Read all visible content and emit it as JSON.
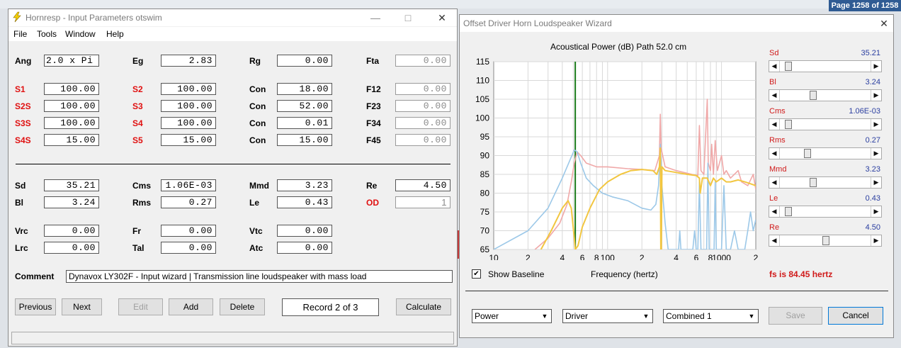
{
  "page_badge": "Page 1258 of 1258",
  "win1": {
    "title": "Hornresp - Input Parameters   otswim",
    "menu": [
      "File",
      "Tools",
      "Window",
      "Help"
    ],
    "row1": [
      {
        "label": "Ang",
        "value": "2.0 x Pi"
      },
      {
        "label": "Eg",
        "value": "2.83"
      },
      {
        "label": "Rg",
        "value": "0.00"
      },
      {
        "label": "Fta",
        "value": "0.00"
      }
    ],
    "horn": [
      [
        {
          "label": "S1",
          "value": "100.00"
        },
        {
          "label": "S2",
          "value": "100.00"
        },
        {
          "label": "Con",
          "value": "18.00"
        },
        {
          "label": "F12",
          "value": "0.00"
        }
      ],
      [
        {
          "label": "S2S",
          "value": "100.00"
        },
        {
          "label": "S3",
          "value": "100.00"
        },
        {
          "label": "Con",
          "value": "52.00"
        },
        {
          "label": "F23",
          "value": "0.00"
        }
      ],
      [
        {
          "label": "S3S",
          "value": "100.00"
        },
        {
          "label": "S4",
          "value": "100.00"
        },
        {
          "label": "Con",
          "value": "0.01"
        },
        {
          "label": "F34",
          "value": "0.00"
        }
      ],
      [
        {
          "label": "S4S",
          "value": "15.00"
        },
        {
          "label": "S5",
          "value": "15.00"
        },
        {
          "label": "Con",
          "value": "15.00"
        },
        {
          "label": "F45",
          "value": "0.00"
        }
      ]
    ],
    "driver": [
      [
        {
          "label": "Sd",
          "value": "35.21"
        },
        {
          "label": "Cms",
          "value": "1.06E-03"
        },
        {
          "label": "Mmd",
          "value": "3.23"
        },
        {
          "label": "Re",
          "value": "4.50"
        }
      ],
      [
        {
          "label": "Bl",
          "value": "3.24"
        },
        {
          "label": "Rms",
          "value": "0.27"
        },
        {
          "label": "Le",
          "value": "0.43"
        },
        {
          "label": "OD",
          "value": "1"
        }
      ]
    ],
    "chamber": [
      [
        {
          "label": "Vrc",
          "value": "0.00"
        },
        {
          "label": "Fr",
          "value": "0.00"
        },
        {
          "label": "Vtc",
          "value": "0.00"
        }
      ],
      [
        {
          "label": "Lrc",
          "value": "0.00"
        },
        {
          "label": "Tal",
          "value": "0.00"
        },
        {
          "label": "Atc",
          "value": "0.00"
        }
      ]
    ],
    "comment_label": "Comment",
    "comment_value": "Dynavox LY302F - Input wizard | Transmission line loudspeaker with mass load",
    "buttons": {
      "previous": "Previous",
      "next": "Next",
      "edit": "Edit",
      "add": "Add",
      "delete": "Delete",
      "calculate": "Calculate"
    },
    "record": "Record 2 of 3"
  },
  "win2": {
    "title": "Offset Driver Horn Loudspeaker Wizard",
    "chart_heading": "Acoustical Power (dB)   Path 52.0 cm",
    "show_baseline_label": "Show Baseline",
    "show_baseline_mark": "✔",
    "xlabel": "Frequency (hertz)",
    "fs_text": "fs is 84.45 hertz",
    "params": [
      {
        "name": "Sd",
        "value": "35.21",
        "pos": 0.06
      },
      {
        "name": "Bl",
        "value": "3.24",
        "pos": 0.36
      },
      {
        "name": "Cms",
        "value": "1.06E-03",
        "pos": 0.06
      },
      {
        "name": "Rms",
        "value": "0.27",
        "pos": 0.29
      },
      {
        "name": "Mmd",
        "value": "3.23",
        "pos": 0.36
      },
      {
        "name": "Le",
        "value": "0.43",
        "pos": 0.06
      },
      {
        "name": "Re",
        "value": "4.50",
        "pos": 0.51
      }
    ],
    "dropdowns": [
      "Power",
      "Driver",
      "Combined 1"
    ],
    "buttons": {
      "save": "Save",
      "cancel": "Cancel"
    }
  },
  "chart_data": {
    "type": "line",
    "title": "Acoustical Power (dB)   Path 52.0 cm",
    "xlabel": "Frequency (hertz)",
    "ylabel": "",
    "x_scale": "log",
    "xlim": [
      10,
      2000
    ],
    "ylim": [
      65,
      115
    ],
    "y_ticks": [
      65,
      70,
      75,
      80,
      85,
      90,
      95,
      100,
      105,
      110,
      115
    ],
    "x_tick_labels": [
      {
        "f": 10,
        "t": "10"
      },
      {
        "f": 20,
        "t": "2"
      },
      {
        "f": 40,
        "t": "4"
      },
      {
        "f": 60,
        "t": "6"
      },
      {
        "f": 80,
        "t": "8"
      },
      {
        "f": 100,
        "t": "100"
      },
      {
        "f": 200,
        "t": "2"
      },
      {
        "f": 400,
        "t": "4"
      },
      {
        "f": 600,
        "t": "6"
      },
      {
        "f": 800,
        "t": "8"
      },
      {
        "f": 1000,
        "t": "1000"
      },
      {
        "f": 2000,
        "t": "2"
      }
    ],
    "grid": true,
    "marker_line": {
      "x": 52,
      "color": "#1a7a1a"
    },
    "series": [
      {
        "color": "#f0a8a8",
        "points": [
          [
            23,
            65
          ],
          [
            30,
            68
          ],
          [
            38,
            72
          ],
          [
            44,
            77
          ],
          [
            48,
            83
          ],
          [
            51,
            88
          ],
          [
            54,
            91
          ],
          [
            58,
            90
          ],
          [
            65,
            88
          ],
          [
            80,
            87
          ],
          [
            100,
            87
          ],
          [
            150,
            86.5
          ],
          [
            200,
            86.3
          ],
          [
            260,
            86
          ],
          [
            285,
            90
          ],
          [
            290,
            101
          ],
          [
            295,
            92
          ],
          [
            320,
            87
          ],
          [
            400,
            86
          ],
          [
            550,
            85
          ],
          [
            620,
            84.7
          ],
          [
            640,
            98
          ],
          [
            660,
            86
          ],
          [
            700,
            85
          ],
          [
            750,
            105
          ],
          [
            765,
            88
          ],
          [
            800,
            86
          ],
          [
            820,
            93
          ],
          [
            850,
            85
          ],
          [
            880,
            94
          ],
          [
            920,
            86
          ],
          [
            1000,
            90
          ],
          [
            1050,
            85
          ],
          [
            1100,
            86
          ],
          [
            1200,
            84
          ],
          [
            1400,
            86
          ],
          [
            1500,
            83
          ],
          [
            1700,
            82
          ],
          [
            1900,
            85
          ],
          [
            2000,
            81
          ]
        ]
      },
      {
        "color": "#9cc8e8",
        "points": [
          [
            10,
            65
          ],
          [
            20,
            70
          ],
          [
            30,
            76
          ],
          [
            40,
            84
          ],
          [
            47,
            89
          ],
          [
            51,
            91.5
          ],
          [
            54,
            91
          ],
          [
            58,
            88
          ],
          [
            65,
            84
          ],
          [
            75,
            82
          ],
          [
            90,
            80
          ],
          [
            110,
            79
          ],
          [
            150,
            78
          ],
          [
            200,
            76
          ],
          [
            240,
            75.5
          ],
          [
            265,
            77
          ],
          [
            280,
            82
          ],
          [
            290,
            93
          ],
          [
            300,
            82
          ],
          [
            320,
            72
          ],
          [
            340,
            65
          ],
          [
            420,
            65
          ],
          [
            430,
            70
          ],
          [
            440,
            65
          ],
          [
            560,
            65
          ],
          [
            580,
            70
          ],
          [
            600,
            65
          ],
          [
            620,
            65
          ],
          [
            640,
            83
          ],
          [
            660,
            65
          ],
          [
            740,
            65
          ],
          [
            760,
            88
          ],
          [
            780,
            65
          ],
          [
            860,
            65
          ],
          [
            880,
            83
          ],
          [
            900,
            65
          ],
          [
            1000,
            65
          ],
          [
            1050,
            82
          ],
          [
            1100,
            65
          ],
          [
            1200,
            65
          ],
          [
            1300,
            70
          ],
          [
            1400,
            65
          ],
          [
            1600,
            65
          ],
          [
            1700,
            70
          ],
          [
            1800,
            75
          ],
          [
            1900,
            70
          ],
          [
            2000,
            73
          ]
        ]
      },
      {
        "color": "#f2c640",
        "points": [
          [
            26,
            65
          ],
          [
            32,
            70
          ],
          [
            40,
            76
          ],
          [
            45,
            78
          ],
          [
            48,
            76
          ],
          [
            51,
            68
          ],
          [
            52,
            65
          ],
          [
            55,
            66
          ],
          [
            60,
            71
          ],
          [
            70,
            76
          ],
          [
            85,
            81
          ],
          [
            100,
            83
          ],
          [
            130,
            85
          ],
          [
            160,
            86
          ],
          [
            200,
            86.3
          ],
          [
            250,
            86
          ],
          [
            270,
            85
          ],
          [
            285,
            87
          ],
          [
            290,
            92
          ],
          [
            293,
            65
          ],
          [
            296,
            65
          ],
          [
            300,
            87
          ],
          [
            320,
            86
          ],
          [
            400,
            85.5
          ],
          [
            500,
            85
          ],
          [
            600,
            84.7
          ],
          [
            640,
            84
          ],
          [
            650,
            80
          ],
          [
            680,
            84
          ],
          [
            750,
            84
          ],
          [
            800,
            82
          ],
          [
            850,
            84
          ],
          [
            900,
            83
          ],
          [
            1000,
            84
          ],
          [
            1100,
            83
          ],
          [
            1200,
            83
          ],
          [
            1400,
            83.5
          ],
          [
            1600,
            83
          ],
          [
            1800,
            82.5
          ],
          [
            2000,
            82
          ]
        ]
      }
    ]
  }
}
